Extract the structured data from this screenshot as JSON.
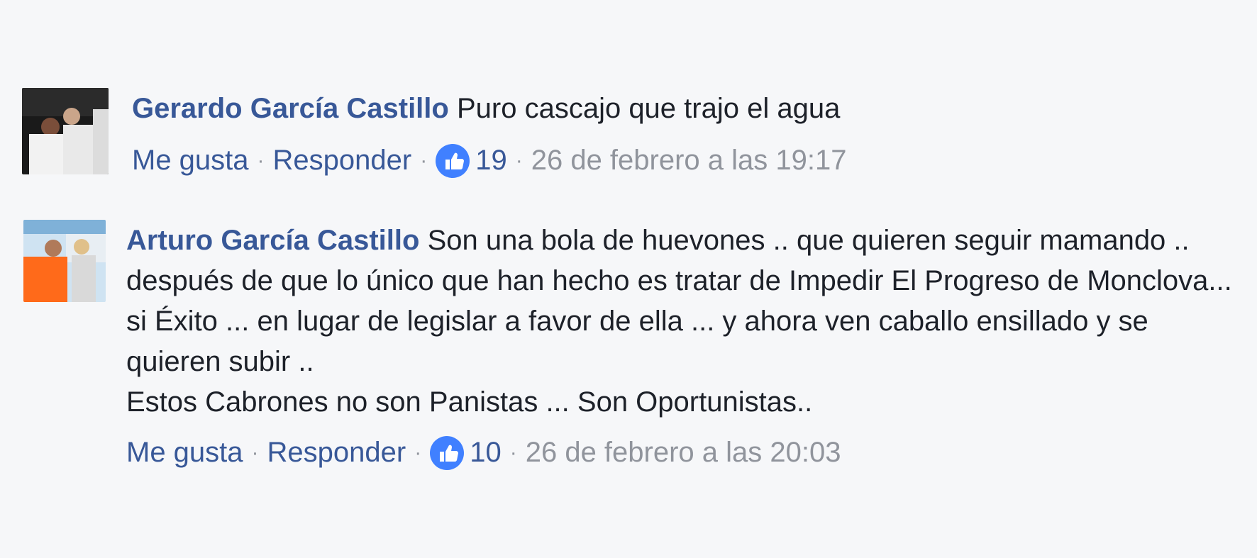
{
  "comments": [
    {
      "author": "Gerardo García Castillo",
      "text": "Puro cascajo que trajo el agua",
      "like_label": "Me gusta",
      "reply_label": "Responder",
      "like_count": "19",
      "timestamp": "26 de febrero a las 19:17"
    },
    {
      "author": "Arturo García Castillo",
      "text": "Son una bola de huevones .. que quieren seguir mamando .. después de que lo único que han hecho es tratar de Impedir El Progreso de Monclova... si Éxito ... en lugar de legislar a favor de ella ... y ahora ven caballo ensillado y se quieren subir ..",
      "text_line2": "Estos Cabrones no son Panistas ... Son Oportunistas..",
      "like_label": "Me gusta",
      "reply_label": "Responder",
      "like_count": "10",
      "timestamp": "26 de febrero a las 20:03"
    }
  ],
  "separator": "·",
  "icons": {
    "reaction": "thumbs-up-icon"
  },
  "colors": {
    "link": "#385898",
    "meta": "#90949c",
    "like_badge": "#4080ff",
    "background": "#f6f7f9"
  }
}
